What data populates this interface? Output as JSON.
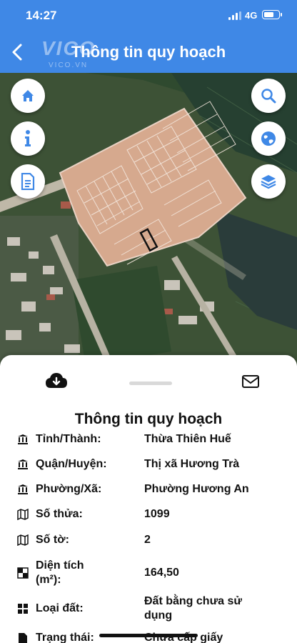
{
  "status_bar": {
    "time": "14:27",
    "network": "4G",
    "battery_level": 0.7
  },
  "header": {
    "title": "Thông tin quy hoạch",
    "watermark_brand": "VICO",
    "watermark_domain": "VICO.VN"
  },
  "map_buttons": {
    "left": [
      "home-icon",
      "info-icon",
      "document-icon"
    ],
    "right": [
      "search-icon",
      "globe-icon",
      "layers-icon"
    ]
  },
  "sheet": {
    "title": "Thông tin quy hoạch",
    "rows": [
      {
        "icon": "bank-icon",
        "label": "Tỉnh/Thành:",
        "value": "Thừa Thiên Huế"
      },
      {
        "icon": "bank-icon",
        "label": "Quận/Huyện:",
        "value": "Thị xã Hương Trà"
      },
      {
        "icon": "bank-icon",
        "label": "Phường/Xã:",
        "value": "Phường Hương An"
      },
      {
        "icon": "map-icon",
        "label": "Số thửa:",
        "value": "1099"
      },
      {
        "icon": "map-icon",
        "label": "Số tờ:",
        "value": "2"
      },
      {
        "icon": "area-icon",
        "label": "Diện tích",
        "label2": "(m²):",
        "value": "164,50"
      },
      {
        "icon": "grid-icon",
        "label": "Loại đất:",
        "value": "Đất bằng chưa sử",
        "value2": "dụng"
      },
      {
        "icon": "doc-icon",
        "label": "Trạng thái:",
        "value": "Chưa cấp giấy"
      }
    ]
  }
}
